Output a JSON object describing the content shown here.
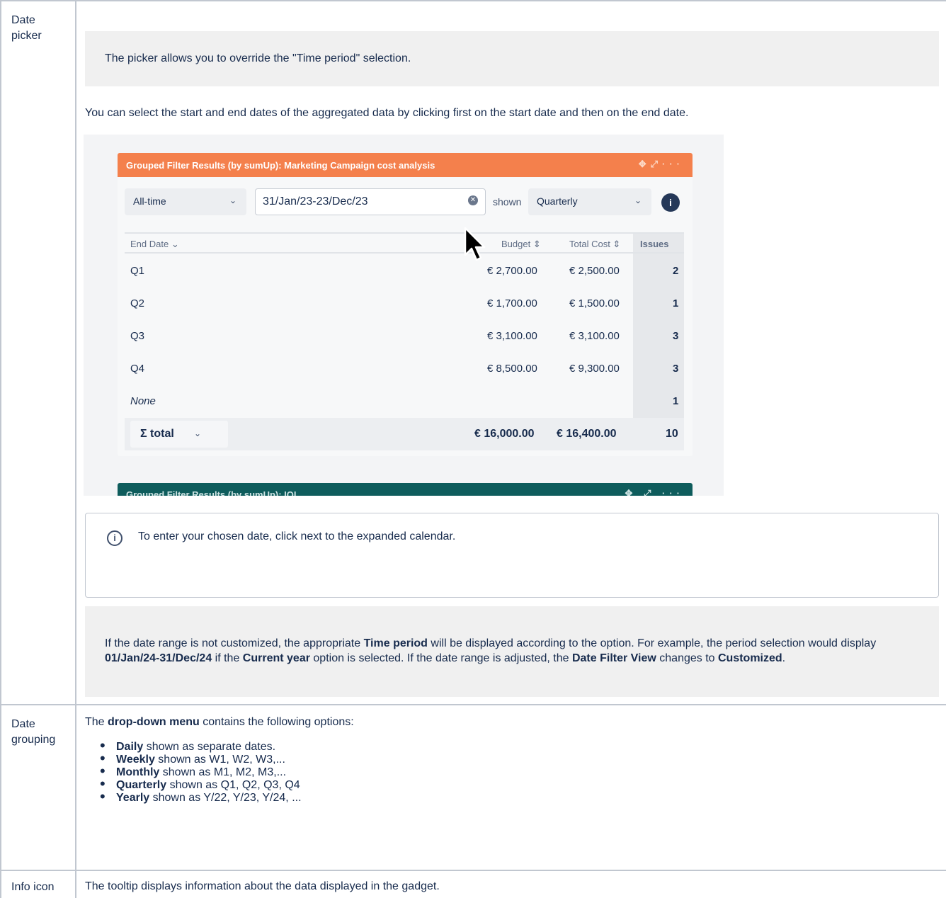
{
  "rows": {
    "date_picker_label": "Date picker",
    "date_grouping_label": "Date grouping",
    "info_icon_label": "Info icon"
  },
  "picker": {
    "panel_text": "The picker allows you to override the \"Time period\" selection.",
    "instruction": "You can select the start and end dates of the aggregated data by clicking first on the start date and then on the end date."
  },
  "screenshot": {
    "gadget_title": "Grouped Filter Results (by sumUp): Marketing Campaign cost analysis",
    "time_period": "All-time",
    "date_range": "31/Jan/23-23/Dec/23",
    "shown_label": "shown",
    "grouping": "Quarterly",
    "info": "i",
    "columns": [
      "End Date",
      "Budget",
      "Total Cost",
      "Issues"
    ],
    "rows": [
      {
        "label": "Q1",
        "budget": "€ 2,700.00",
        "cost": "€ 2,500.00",
        "issues": "2"
      },
      {
        "label": "Q2",
        "budget": "€ 1,700.00",
        "cost": "€ 1,500.00",
        "issues": "1"
      },
      {
        "label": "Q3",
        "budget": "€ 3,100.00",
        "cost": "€ 3,100.00",
        "issues": "3"
      },
      {
        "label": "Q4",
        "budget": "€ 8,500.00",
        "cost": "€ 9,300.00",
        "issues": "3"
      },
      {
        "label": "None",
        "budget": "",
        "cost": "",
        "issues": "1"
      }
    ],
    "total_label": "Σ total",
    "total_budget": "€ 16,000.00",
    "total_cost": "€ 16,400.00",
    "total_issues": "10",
    "gadget2_title": "Grouped Filter Results (by sumUp): IQI"
  },
  "info_box": {
    "message": "To enter your chosen date, click next to the expanded calendar."
  },
  "note": {
    "p1": "If the date range is not customized, the appropriate ",
    "b1": "Time period",
    "p2": " will be displayed according to the option. For example, the period selection would display ",
    "b2": "01/Jan/24-31/Dec/24",
    "p3": " if the ",
    "b3": "Current year",
    "p4": " option is selected. If the date range is adjusted, the ",
    "b4": "Date Filter View",
    "p5": " changes to ",
    "b5": "Customized",
    "p6": "."
  },
  "grouping": {
    "intro_pre": "The ",
    "intro_bold": "drop-down menu",
    "intro_post": " contains the following options:",
    "options": [
      {
        "name": "Daily",
        "desc": " shown as separate dates."
      },
      {
        "name": "Weekly",
        "desc": " shown as W1, W2, W3,..."
      },
      {
        "name": "Monthly",
        "desc": " shown as M1, M2, M3,..."
      },
      {
        "name": "Quarterly",
        "desc": " shown as Q1, Q2, Q3, Q4"
      },
      {
        "name": "Yearly",
        "desc": " shown as Y/22, Y/23, Y/24, ..."
      }
    ]
  },
  "info_icon": {
    "text": "The tooltip displays information about the data displayed in the gadget."
  }
}
